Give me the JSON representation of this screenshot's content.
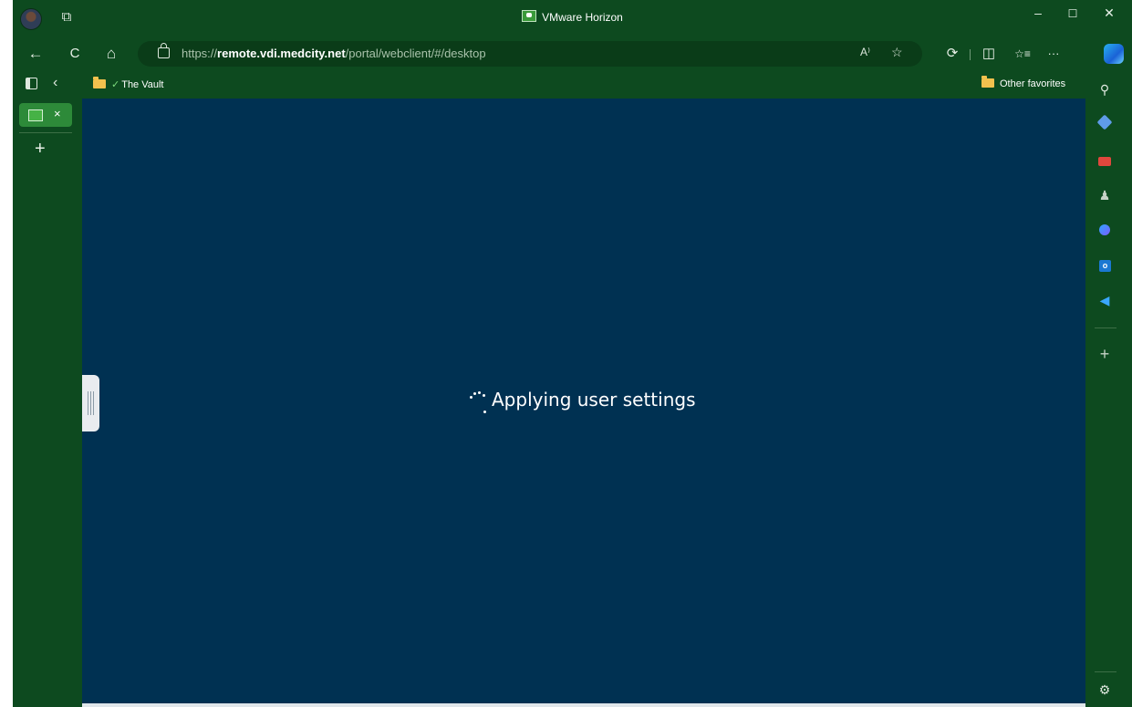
{
  "window": {
    "title": "VMware Horizon"
  },
  "titlebar": {
    "minimize": "–",
    "maximize": "☐",
    "close": "✕"
  },
  "nav": {
    "back": "←",
    "refresh": "C",
    "home": "⌂",
    "url_prefix": "https://",
    "url_host": "remote.vdi.medcity.net",
    "url_path": "/portal/webclient/#/desktop",
    "read_aloud": "A⁾",
    "favorite": "☆",
    "extensions": "⟳",
    "split": "◫",
    "favorites": "☆≡",
    "more": "···"
  },
  "favorites_bar": {
    "items": [
      {
        "label": "The Vault"
      }
    ],
    "other": "Other favorites"
  },
  "tabs": {
    "close": "×",
    "new_tab": "+"
  },
  "content": {
    "status": "Applying user settings"
  },
  "sidebar": {
    "add": "+",
    "settings": "⚙"
  }
}
